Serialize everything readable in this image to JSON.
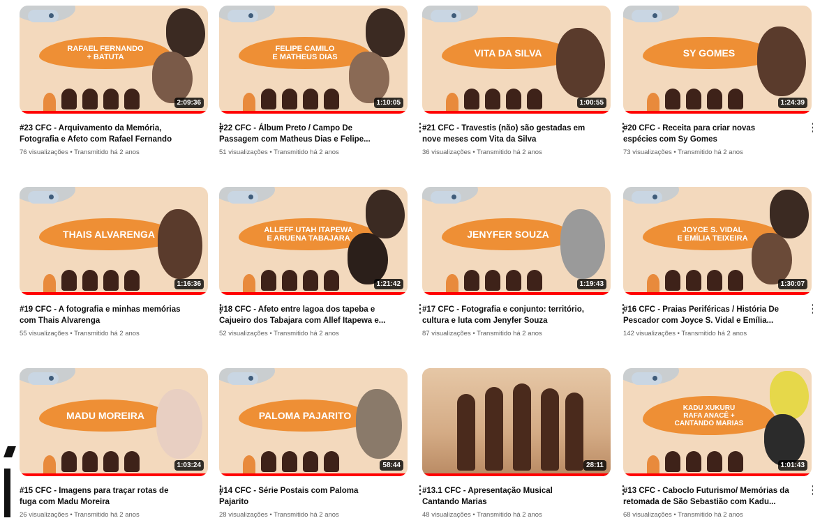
{
  "videos": [
    {
      "banner": "RAFAEL FERNANDO\n+ BATUTA",
      "duration": "2:09:36",
      "title": "#23 CFC - Arquivamento da Memória, Fotografia e Afeto com Rafael Fernando",
      "views": "76 visualizações",
      "streamed": "Transmitido há 2 anos"
    },
    {
      "banner": "FELIPE CAMILO\nE MATHEUS DIAS",
      "duration": "1:10:05",
      "title": "#22 CFC - Álbum Preto / Campo De Passagem com Matheus Dias e Felipe...",
      "views": "51 visualizações",
      "streamed": "Transmitido há 2 anos"
    },
    {
      "banner": "VITA DA SILVA",
      "duration": "1:00:55",
      "title": "#21 CFC - Travestis (não) são gestadas em nove meses com Vita da Silva",
      "views": "36 visualizações",
      "streamed": "Transmitido há 2 anos"
    },
    {
      "banner": "SY GOMES",
      "duration": "1:24:39",
      "title": "#20 CFC - Receita para criar novas espécies com Sy Gomes",
      "views": "73 visualizações",
      "streamed": "Transmitido há 2 anos"
    },
    {
      "banner": "THAIS ALVARENGA",
      "duration": "1:16:36",
      "title": "#19 CFC - A fotografia e minhas memórias com Thais Alvarenga",
      "views": "55 visualizações",
      "streamed": "Transmitido há 2 anos"
    },
    {
      "banner": "ALLEFF UTAH ITAPEWA\nE ARUENA TABAJARA",
      "duration": "1:21:42",
      "title": "#18 CFC - Afeto entre lagoa dos tapeba e Cajueiro dos Tabajara com Allef Itapewa e...",
      "views": "52 visualizações",
      "streamed": "Transmitido há 2 anos"
    },
    {
      "banner": "JENYFER SOUZA",
      "duration": "1:19:43",
      "title": "#17 CFC - Fotografia e conjunto: território, cultura e luta com Jenyfer Souza",
      "views": "87 visualizações",
      "streamed": "Transmitido há 2 anos"
    },
    {
      "banner": "JOYCE S. VIDAL\nE EMÍLIA TEIXEIRA",
      "duration": "1:30:07",
      "title": "#16 CFC - Praias Periféricas / História De Pescador com Joyce S. Vidal e Emília...",
      "views": "142 visualizações",
      "streamed": "Transmitido há 2 anos"
    },
    {
      "banner": "MADU MOREIRA",
      "duration": "1:03:24",
      "title": "#15 CFC - Imagens para traçar rotas de fuga com Madu Moreira",
      "views": "26 visualizações",
      "streamed": "Transmitido há 2 anos"
    },
    {
      "banner": "PALOMA PAJARITO",
      "duration": "58:44",
      "title": "#14 CFC - Série Postais com Paloma Pajarito",
      "views": "28 visualizações",
      "streamed": "Transmitido há 2 anos"
    },
    {
      "banner": "",
      "duration": "28:11",
      "title": "#13.1 CFC - Apresentação Musical Cantando Marias",
      "views": "48 visualizações",
      "streamed": "Transmitido há 2 anos"
    },
    {
      "banner": "KADU XUKURU\nRAFA ANACÊ +\nCANTANDO MARIAS",
      "duration": "1:01:43",
      "title": "#13 CFC - Caboclo Futurismo/ Memórias da retomada de São Sebastião com Kadu...",
      "views": "68 visualizações",
      "streamed": "Transmitido há 2 anos"
    }
  ],
  "separator": " • ",
  "more_glyph": "⋮",
  "colors": {
    "banner": "#ee8f35",
    "thumb_bg": "#f3d9bd",
    "progress": "#ff0000",
    "title": "#0f0f0f",
    "meta": "#606060"
  }
}
